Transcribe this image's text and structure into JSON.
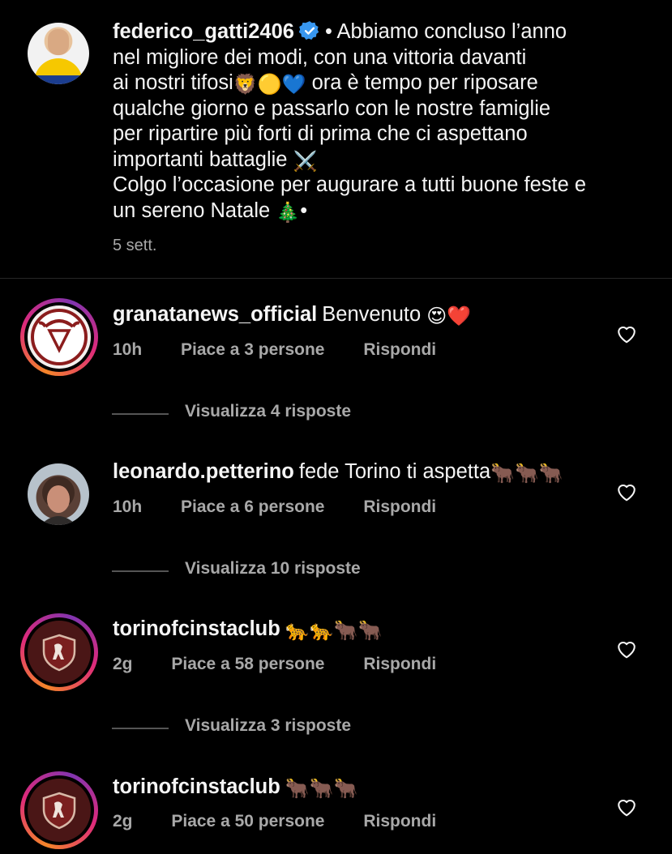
{
  "caption": {
    "username": "federico_gatti2406",
    "text_lines": [
      "• Abbiamo concluso l’anno",
      "nel migliore dei modi, con una vittoria davanti",
      "ai nostri tifosi",
      "ora è tempo per riposare",
      "qualche giorno e passarlo con le nostre famiglie",
      "per ripartire più forti di prima che ci aspettano",
      "importanti battaglie",
      "Colgo l’occasione per augurare a tutti buone feste e",
      "un sereno Natale",
      "•"
    ],
    "emoji_tifosi": "🦁🟡💙",
    "emoji_battaglie": "⚔️",
    "emoji_natale": "🎄",
    "time": "5 sett."
  },
  "comments": [
    {
      "username": "granatanews_official",
      "text": "Benvenuto",
      "emoji": "😍❤️",
      "time": "10h",
      "likes": "Piace a 3 persone",
      "reply": "Rispondi",
      "view_replies": "Visualizza 4 risposte"
    },
    {
      "username": "leonardo.petterino",
      "text": "fede Torino ti aspetta",
      "emoji": "🐂🐂🐂",
      "time": "10h",
      "likes": "Piace a 6 persone",
      "reply": "Rispondi",
      "view_replies": "Visualizza 10 risposte"
    },
    {
      "username": "torinofcinstaclub",
      "text": "",
      "emoji": "🐆🐆🐂🐂",
      "time": "2g",
      "likes": "Piace a 58 persone",
      "reply": "Rispondi",
      "view_replies": "Visualizza 3 risposte"
    },
    {
      "username": "torinofcinstaclub",
      "text": "",
      "emoji": "🐂🐂🐂",
      "time": "2g",
      "likes": "Piace a 50 persone",
      "reply": "Rispondi"
    }
  ],
  "icons": {
    "verified": "verified-badge-icon",
    "heart": "heart-outline-icon"
  },
  "colors": {
    "background": "#000000",
    "text": "#f5f5f5",
    "secondary": "#a8a8a8",
    "verified": "#3897f0",
    "ring_start": "#f58529",
    "ring_end": "#dd2a7b"
  }
}
